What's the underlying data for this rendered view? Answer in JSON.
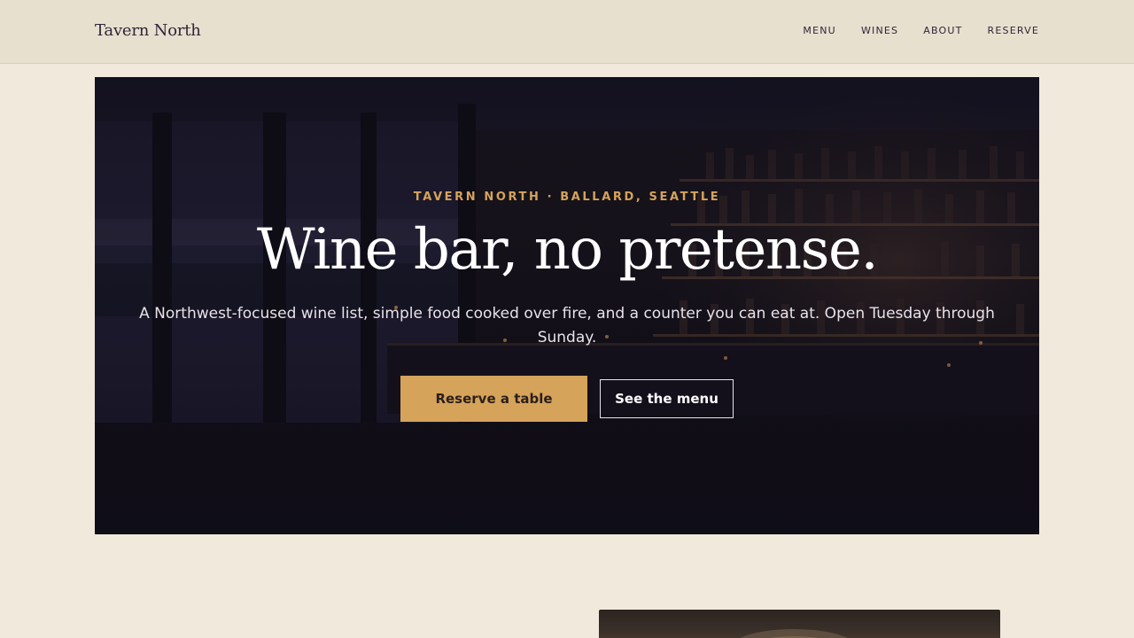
{
  "header": {
    "logo": "Tavern North",
    "nav": [
      {
        "label": "MENU"
      },
      {
        "label": "WINES"
      },
      {
        "label": "ABOUT"
      },
      {
        "label": "RESERVE"
      }
    ]
  },
  "hero": {
    "eyebrow": "TAVERN NORTH · BALLARD, SEATTLE",
    "headline": "Wine bar, no pretense.",
    "lede": "A Northwest-focused wine list, simple food cooked over fire, and a counter you can eat at. Open Tuesday through Sunday.",
    "primary_cta": "Reserve a table",
    "secondary_cta": "See the menu"
  },
  "colors": {
    "page_bg": "#f1e9dc",
    "header_bg": "#e8e0cf",
    "accent": "#d6a35a",
    "hero_bg": "#15121f"
  }
}
